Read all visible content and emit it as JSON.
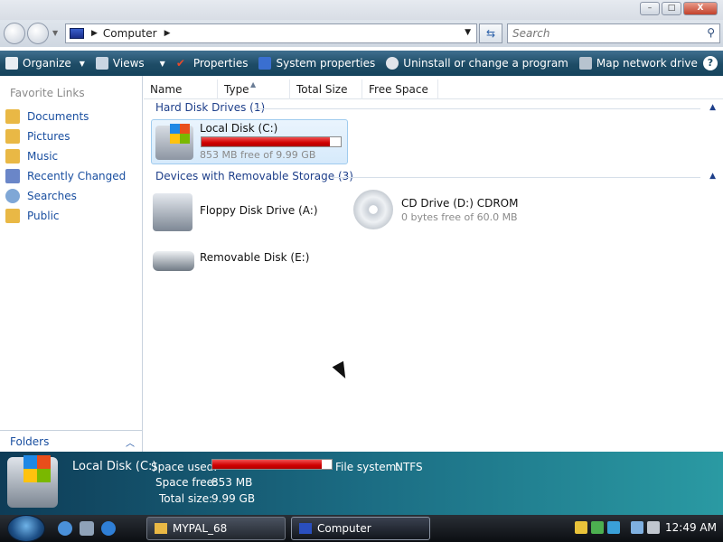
{
  "window": {
    "min_label": "–",
    "max_label": "□",
    "close_label": "X"
  },
  "address": {
    "breadcrumb": "Computer",
    "search_placeholder": "Search"
  },
  "toolbar": {
    "items": [
      {
        "label": "Organize",
        "has_caret": true
      },
      {
        "label": "Views",
        "has_caret": true
      },
      {
        "label": "Properties"
      },
      {
        "label": "System properties"
      },
      {
        "label": "Uninstall or change a program"
      },
      {
        "label": "Map network drive"
      }
    ],
    "overflow": "»",
    "help": "?"
  },
  "sidebar": {
    "title": "Favorite Links",
    "items": [
      {
        "label": "Documents",
        "icon": "documents-folder-icon",
        "color": "#e9b845"
      },
      {
        "label": "Pictures",
        "icon": "pictures-folder-icon",
        "color": "#e9b845"
      },
      {
        "label": "Music",
        "icon": "music-folder-icon",
        "color": "#e9b845"
      },
      {
        "label": "Recently Changed",
        "icon": "recent-changed-icon",
        "color": "#6a86c8"
      },
      {
        "label": "Searches",
        "icon": "search-magnifier-icon",
        "color": "#7fa7d6"
      },
      {
        "label": "Public",
        "icon": "public-folder-icon",
        "color": "#e9b845"
      }
    ],
    "folders_label": "Folders"
  },
  "columns": [
    "Name",
    "Type",
    "Total Size",
    "Free Space"
  ],
  "groups": {
    "hard_disks": {
      "title": "Hard Disk Drives (1)",
      "drives": [
        {
          "name": "Local Disk (C:)",
          "detail": "853 MB free of 9.99 GB",
          "used_fraction": 0.92
        }
      ]
    },
    "removable": {
      "title": "Devices with Removable Storage (3)",
      "drives": [
        {
          "name": "Floppy Disk Drive (A:)"
        },
        {
          "name": "CD Drive (D:) CDROM",
          "detail": "0 bytes free of 60.0 MB"
        },
        {
          "name": "Removable Disk (E:)"
        }
      ]
    }
  },
  "details": {
    "title": "Local Disk (C:)",
    "space_used_label": "Space used:",
    "space_used_fraction": 0.92,
    "file_system_label": "File system:",
    "file_system_value": "NTFS",
    "space_free_label": "Space free:",
    "space_free_value": "853 MB",
    "total_size_label": "Total size:",
    "total_size_value": "9.99 GB"
  },
  "taskbar": {
    "tasks": [
      {
        "label": "MYPAL_68"
      },
      {
        "label": "Computer"
      }
    ],
    "clock": "12:49 AM"
  },
  "colors": {
    "usage_bar": "#d00000",
    "command_bar": "#1e4c66",
    "link": "#1a4fa0"
  }
}
